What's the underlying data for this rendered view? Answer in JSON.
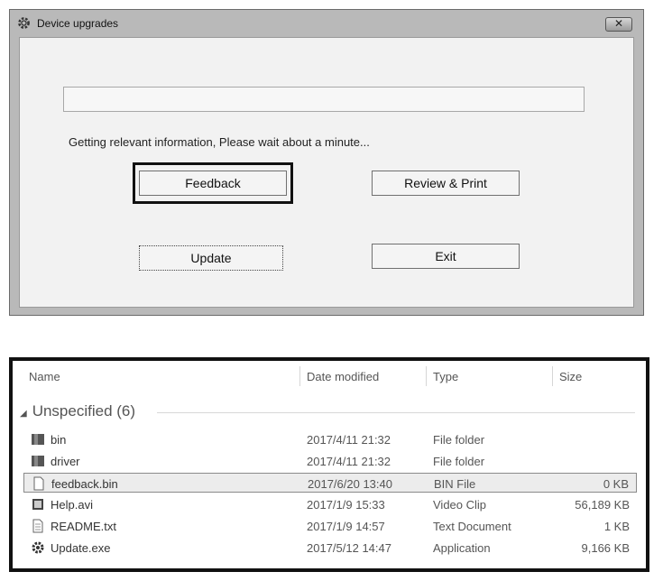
{
  "dialog": {
    "title": "Device upgrades",
    "close_label": "✕",
    "progress_percent": 0,
    "status_text": "Getting relevant information, Please wait about a minute...",
    "buttons": {
      "feedback": "Feedback",
      "review_print": "Review & Print",
      "update": "Update",
      "exit": "Exit"
    }
  },
  "explorer": {
    "columns": {
      "name": "Name",
      "date": "Date modified",
      "type": "Type",
      "size": "Size"
    },
    "group_label": "Unspecified (6)",
    "files": [
      {
        "name": "bin",
        "date": "2017/4/11 21:32",
        "type": "File folder",
        "size": "",
        "icon": "folder-icon"
      },
      {
        "name": "driver",
        "date": "2017/4/11 21:32",
        "type": "File folder",
        "size": "",
        "icon": "folder-icon"
      },
      {
        "name": "feedback.bin",
        "date": "2017/6/20 13:40",
        "type": "BIN File",
        "size": "0 KB",
        "icon": "file-icon"
      },
      {
        "name": "Help.avi",
        "date": "2017/1/9 15:33",
        "type": "Video Clip",
        "size": "56,189 KB",
        "icon": "video-icon"
      },
      {
        "name": "README.txt",
        "date": "2017/1/9 14:57",
        "type": "Text Document",
        "size": "1 KB",
        "icon": "text-file-icon"
      },
      {
        "name": "Update.exe",
        "date": "2017/5/12 14:47",
        "type": "Application",
        "size": "9,166 KB",
        "icon": "gear-icon"
      }
    ]
  }
}
